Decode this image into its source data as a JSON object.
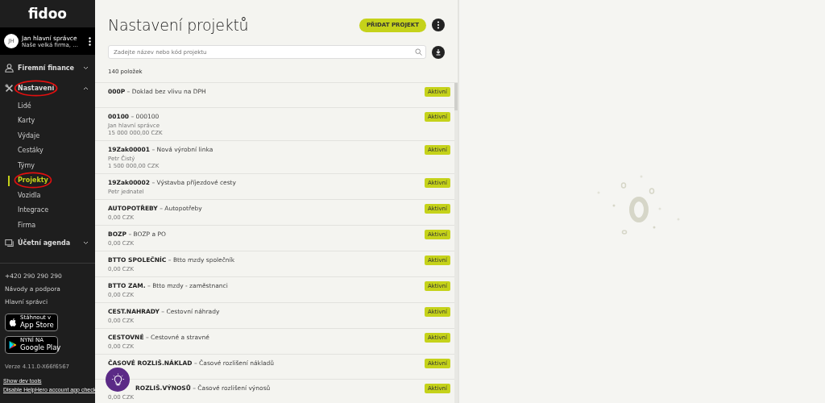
{
  "sidebar": {
    "logo": "fidoo",
    "user": {
      "initials": "JH",
      "name": "Jan hlavní správce",
      "company": "Naše velká firma, ..."
    },
    "nav": [
      {
        "label": "Firemní finance",
        "expanded": false,
        "annotated": false
      },
      {
        "label": "Nastavení",
        "expanded": true,
        "annotated": true,
        "children": [
          {
            "label": "Lidé",
            "selected": false,
            "annotated": false
          },
          {
            "label": "Karty",
            "selected": false,
            "annotated": false
          },
          {
            "label": "Výdaje",
            "selected": false,
            "annotated": false
          },
          {
            "label": "Cestáky",
            "selected": false,
            "annotated": false
          },
          {
            "label": "Týmy",
            "selected": false,
            "annotated": false
          },
          {
            "label": "Projekty",
            "selected": true,
            "annotated": true
          },
          {
            "label": "Vozidla",
            "selected": false,
            "annotated": false
          },
          {
            "label": "Integrace",
            "selected": false,
            "annotated": false
          },
          {
            "label": "Firma",
            "selected": false,
            "annotated": false
          }
        ]
      },
      {
        "label": "Účetní agenda",
        "expanded": false,
        "annotated": false
      }
    ],
    "links": [
      "+420 290 290 290",
      "Návody a podpora",
      "Hlavní správci"
    ],
    "stores": [
      {
        "kind": "apple",
        "small": "Stáhnout v",
        "big": "App Store"
      },
      {
        "kind": "google",
        "small": "NYNÍ NA",
        "big": "Google Play"
      }
    ],
    "version": "Verze 4.11.0-X66f6567",
    "dev_links": [
      "Show dev tools",
      "Disable HelpHero account app check"
    ]
  },
  "main": {
    "title": "Nastavení projektů",
    "add_button": "PŘIDAT PROJEKT",
    "search": {
      "placeholder": "Zadejte název nebo kód projektu"
    },
    "count": "140 položek",
    "projects": [
      {
        "title": "**000P** – Doklad bez vlivu na DPH",
        "status": "Aktivní"
      },
      {
        "title": "**00100** – 000100",
        "details": [
          "Jan hlavní správce",
          "15 000 000,00 CZK"
        ],
        "status": "Aktivní"
      },
      {
        "title": "**19Zak00001** – Nová výrobní linka",
        "details": [
          "Petr Čistý",
          "1 500 000,00 CZK"
        ],
        "status": "Aktivní"
      },
      {
        "title": "**19Zak00002** – Výstavba příjezdové cesty",
        "details": [
          "Petr jednatel"
        ],
        "status": "Aktivní"
      },
      {
        "title": "**AUTOPOTŘEBY** – Autopotřeby",
        "details": [
          "0,00 CZK"
        ],
        "status": "Aktivní"
      },
      {
        "title": "**BOZP** – BOZP a PO",
        "details": [
          "0,00 CZK"
        ],
        "status": "Aktivní"
      },
      {
        "title": "**BTTO SPOLEČNÍC** – Btto mzdy společník",
        "details": [
          "0,00 CZK"
        ],
        "status": "Aktivní"
      },
      {
        "title": "**BTTO ZAM.** – Btto mzdy - zaměstnanci",
        "details": [
          "0,00 CZK"
        ],
        "status": "Aktivní"
      },
      {
        "title": "**CEST.NAHRADY** – Cestovní náhrady",
        "details": [
          "0,00 CZK"
        ],
        "status": "Aktivní"
      },
      {
        "title": "**CESTOVNÉ** – Cestovné a stravné",
        "details": [
          "0,00 CZK"
        ],
        "status": "Aktivní"
      },
      {
        "title": "**ČASOVÉ ROZLIŠ.NÁKLAD** – Časové rozlišení nákladů",
        "status": "Aktivní"
      },
      {
        "title": "**ROZLIŠ.VÝNOSŮ** – Časové rozlišení výnosů",
        "details": [
          "0,00 CZK"
        ],
        "status": "Aktivní"
      }
    ]
  }
}
